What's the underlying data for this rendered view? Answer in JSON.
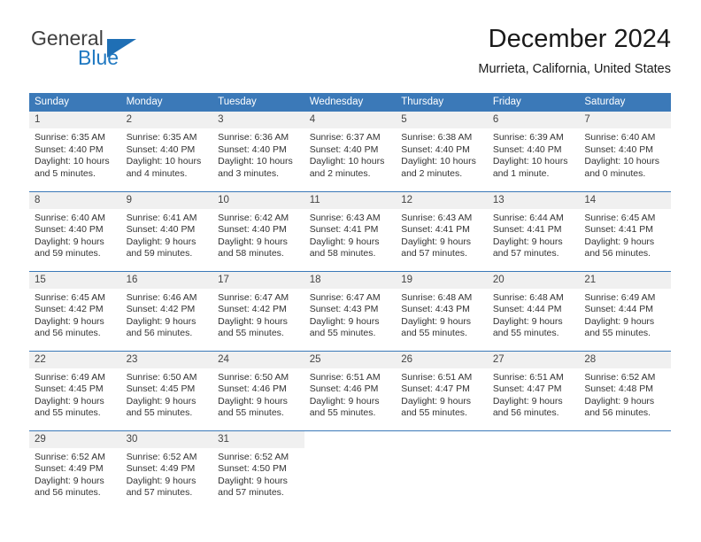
{
  "brand": {
    "name_top": "General",
    "name_bottom": "Blue",
    "triangle_color": "#1f6fb5",
    "text_color": "#3f3f3f",
    "blue_color": "#1f78c1"
  },
  "header": {
    "title": "December 2024",
    "subtitle": "Murrieta, California, United States"
  },
  "theme": {
    "header_bg": "#3b79b8",
    "header_text": "#ffffff",
    "daynum_bg": "#f0f0f0",
    "row_border": "#3b79b8",
    "body_text": "#333333"
  },
  "weekday_headers": [
    "Sunday",
    "Monday",
    "Tuesday",
    "Wednesday",
    "Thursday",
    "Friday",
    "Saturday"
  ],
  "weeks": [
    [
      {
        "day": "1",
        "sunrise": "Sunrise: 6:35 AM",
        "sunset": "Sunset: 4:40 PM",
        "daylight1": "Daylight: 10 hours",
        "daylight2": "and 5 minutes."
      },
      {
        "day": "2",
        "sunrise": "Sunrise: 6:35 AM",
        "sunset": "Sunset: 4:40 PM",
        "daylight1": "Daylight: 10 hours",
        "daylight2": "and 4 minutes."
      },
      {
        "day": "3",
        "sunrise": "Sunrise: 6:36 AM",
        "sunset": "Sunset: 4:40 PM",
        "daylight1": "Daylight: 10 hours",
        "daylight2": "and 3 minutes."
      },
      {
        "day": "4",
        "sunrise": "Sunrise: 6:37 AM",
        "sunset": "Sunset: 4:40 PM",
        "daylight1": "Daylight: 10 hours",
        "daylight2": "and 2 minutes."
      },
      {
        "day": "5",
        "sunrise": "Sunrise: 6:38 AM",
        "sunset": "Sunset: 4:40 PM",
        "daylight1": "Daylight: 10 hours",
        "daylight2": "and 2 minutes."
      },
      {
        "day": "6",
        "sunrise": "Sunrise: 6:39 AM",
        "sunset": "Sunset: 4:40 PM",
        "daylight1": "Daylight: 10 hours",
        "daylight2": "and 1 minute."
      },
      {
        "day": "7",
        "sunrise": "Sunrise: 6:40 AM",
        "sunset": "Sunset: 4:40 PM",
        "daylight1": "Daylight: 10 hours",
        "daylight2": "and 0 minutes."
      }
    ],
    [
      {
        "day": "8",
        "sunrise": "Sunrise: 6:40 AM",
        "sunset": "Sunset: 4:40 PM",
        "daylight1": "Daylight: 9 hours",
        "daylight2": "and 59 minutes."
      },
      {
        "day": "9",
        "sunrise": "Sunrise: 6:41 AM",
        "sunset": "Sunset: 4:40 PM",
        "daylight1": "Daylight: 9 hours",
        "daylight2": "and 59 minutes."
      },
      {
        "day": "10",
        "sunrise": "Sunrise: 6:42 AM",
        "sunset": "Sunset: 4:40 PM",
        "daylight1": "Daylight: 9 hours",
        "daylight2": "and 58 minutes."
      },
      {
        "day": "11",
        "sunrise": "Sunrise: 6:43 AM",
        "sunset": "Sunset: 4:41 PM",
        "daylight1": "Daylight: 9 hours",
        "daylight2": "and 58 minutes."
      },
      {
        "day": "12",
        "sunrise": "Sunrise: 6:43 AM",
        "sunset": "Sunset: 4:41 PM",
        "daylight1": "Daylight: 9 hours",
        "daylight2": "and 57 minutes."
      },
      {
        "day": "13",
        "sunrise": "Sunrise: 6:44 AM",
        "sunset": "Sunset: 4:41 PM",
        "daylight1": "Daylight: 9 hours",
        "daylight2": "and 57 minutes."
      },
      {
        "day": "14",
        "sunrise": "Sunrise: 6:45 AM",
        "sunset": "Sunset: 4:41 PM",
        "daylight1": "Daylight: 9 hours",
        "daylight2": "and 56 minutes."
      }
    ],
    [
      {
        "day": "15",
        "sunrise": "Sunrise: 6:45 AM",
        "sunset": "Sunset: 4:42 PM",
        "daylight1": "Daylight: 9 hours",
        "daylight2": "and 56 minutes."
      },
      {
        "day": "16",
        "sunrise": "Sunrise: 6:46 AM",
        "sunset": "Sunset: 4:42 PM",
        "daylight1": "Daylight: 9 hours",
        "daylight2": "and 56 minutes."
      },
      {
        "day": "17",
        "sunrise": "Sunrise: 6:47 AM",
        "sunset": "Sunset: 4:42 PM",
        "daylight1": "Daylight: 9 hours",
        "daylight2": "and 55 minutes."
      },
      {
        "day": "18",
        "sunrise": "Sunrise: 6:47 AM",
        "sunset": "Sunset: 4:43 PM",
        "daylight1": "Daylight: 9 hours",
        "daylight2": "and 55 minutes."
      },
      {
        "day": "19",
        "sunrise": "Sunrise: 6:48 AM",
        "sunset": "Sunset: 4:43 PM",
        "daylight1": "Daylight: 9 hours",
        "daylight2": "and 55 minutes."
      },
      {
        "day": "20",
        "sunrise": "Sunrise: 6:48 AM",
        "sunset": "Sunset: 4:44 PM",
        "daylight1": "Daylight: 9 hours",
        "daylight2": "and 55 minutes."
      },
      {
        "day": "21",
        "sunrise": "Sunrise: 6:49 AM",
        "sunset": "Sunset: 4:44 PM",
        "daylight1": "Daylight: 9 hours",
        "daylight2": "and 55 minutes."
      }
    ],
    [
      {
        "day": "22",
        "sunrise": "Sunrise: 6:49 AM",
        "sunset": "Sunset: 4:45 PM",
        "daylight1": "Daylight: 9 hours",
        "daylight2": "and 55 minutes."
      },
      {
        "day": "23",
        "sunrise": "Sunrise: 6:50 AM",
        "sunset": "Sunset: 4:45 PM",
        "daylight1": "Daylight: 9 hours",
        "daylight2": "and 55 minutes."
      },
      {
        "day": "24",
        "sunrise": "Sunrise: 6:50 AM",
        "sunset": "Sunset: 4:46 PM",
        "daylight1": "Daylight: 9 hours",
        "daylight2": "and 55 minutes."
      },
      {
        "day": "25",
        "sunrise": "Sunrise: 6:51 AM",
        "sunset": "Sunset: 4:46 PM",
        "daylight1": "Daylight: 9 hours",
        "daylight2": "and 55 minutes."
      },
      {
        "day": "26",
        "sunrise": "Sunrise: 6:51 AM",
        "sunset": "Sunset: 4:47 PM",
        "daylight1": "Daylight: 9 hours",
        "daylight2": "and 55 minutes."
      },
      {
        "day": "27",
        "sunrise": "Sunrise: 6:51 AM",
        "sunset": "Sunset: 4:47 PM",
        "daylight1": "Daylight: 9 hours",
        "daylight2": "and 56 minutes."
      },
      {
        "day": "28",
        "sunrise": "Sunrise: 6:52 AM",
        "sunset": "Sunset: 4:48 PM",
        "daylight1": "Daylight: 9 hours",
        "daylight2": "and 56 minutes."
      }
    ],
    [
      {
        "day": "29",
        "sunrise": "Sunrise: 6:52 AM",
        "sunset": "Sunset: 4:49 PM",
        "daylight1": "Daylight: 9 hours",
        "daylight2": "and 56 minutes."
      },
      {
        "day": "30",
        "sunrise": "Sunrise: 6:52 AM",
        "sunset": "Sunset: 4:49 PM",
        "daylight1": "Daylight: 9 hours",
        "daylight2": "and 57 minutes."
      },
      {
        "day": "31",
        "sunrise": "Sunrise: 6:52 AM",
        "sunset": "Sunset: 4:50 PM",
        "daylight1": "Daylight: 9 hours",
        "daylight2": "and 57 minutes."
      },
      {
        "day": "",
        "sunrise": "",
        "sunset": "",
        "daylight1": "",
        "daylight2": ""
      },
      {
        "day": "",
        "sunrise": "",
        "sunset": "",
        "daylight1": "",
        "daylight2": ""
      },
      {
        "day": "",
        "sunrise": "",
        "sunset": "",
        "daylight1": "",
        "daylight2": ""
      },
      {
        "day": "",
        "sunrise": "",
        "sunset": "",
        "daylight1": "",
        "daylight2": ""
      }
    ]
  ]
}
